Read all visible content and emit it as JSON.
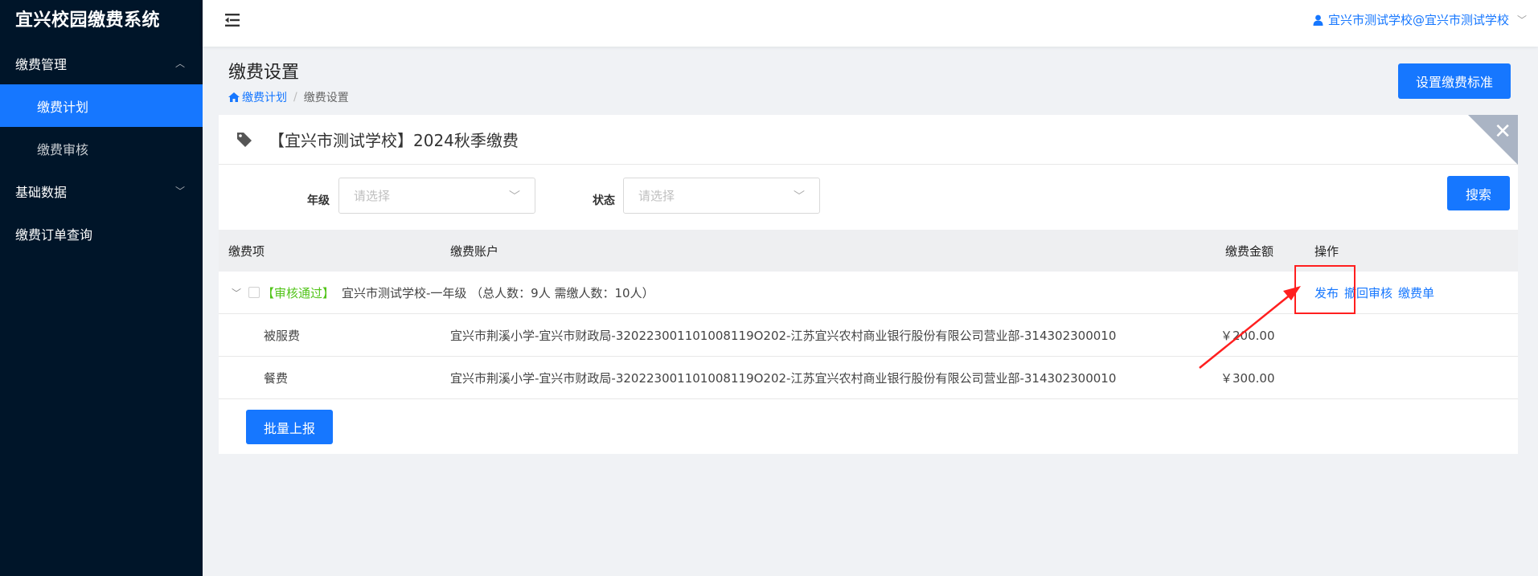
{
  "sidebar": {
    "logo": "宜兴校园缴费系统",
    "groups": [
      {
        "label": "缴费管理",
        "items": [
          {
            "label": "缴费计划",
            "active": true
          },
          {
            "label": "缴费审核",
            "active": false
          }
        ]
      },
      {
        "label": "基础数据"
      },
      {
        "label": "缴费订单查询"
      }
    ]
  },
  "header": {
    "user": "宜兴市测试学校@宜兴市测试学校"
  },
  "page": {
    "title": "缴费设置",
    "breadcrumb": [
      "缴费计划",
      "缴费设置"
    ],
    "set_standard_button": "设置缴费标准"
  },
  "card": {
    "title": "【宜兴市测试学校】2024秋季缴费",
    "filters": {
      "grade_label": "年级",
      "grade_placeholder": "请选择",
      "status_label": "状态",
      "status_placeholder": "请选择",
      "search_button": "搜索"
    },
    "table": {
      "headers": [
        "缴费项",
        "缴费账户",
        "缴费金额",
        "操作"
      ],
      "group": {
        "status": "【审核通过】",
        "text": "宜兴市测试学校-一年级 （总人数：9人 需缴人数：10人）",
        "ops": [
          "发布",
          "撤回审核",
          "缴费单"
        ]
      },
      "rows": [
        {
          "item": "被服费",
          "account": "宜兴市荆溪小学-宜兴市财政局-320223001101008119O202-江苏宜兴农村商业银行股份有限公司营业部-314302300010",
          "amount": "￥200.00"
        },
        {
          "item": "餐费",
          "account": "宜兴市荆溪小学-宜兴市财政局-320223001101008119O202-江苏宜兴农村商业银行股份有限公司营业部-314302300010",
          "amount": "￥300.00"
        }
      ]
    },
    "batch_button": "批量上报"
  },
  "colors": {
    "sidebar_bg": "#001529",
    "primary": "#1677ff",
    "approved": "#52c41a",
    "annotation": "#ff1f1f"
  }
}
